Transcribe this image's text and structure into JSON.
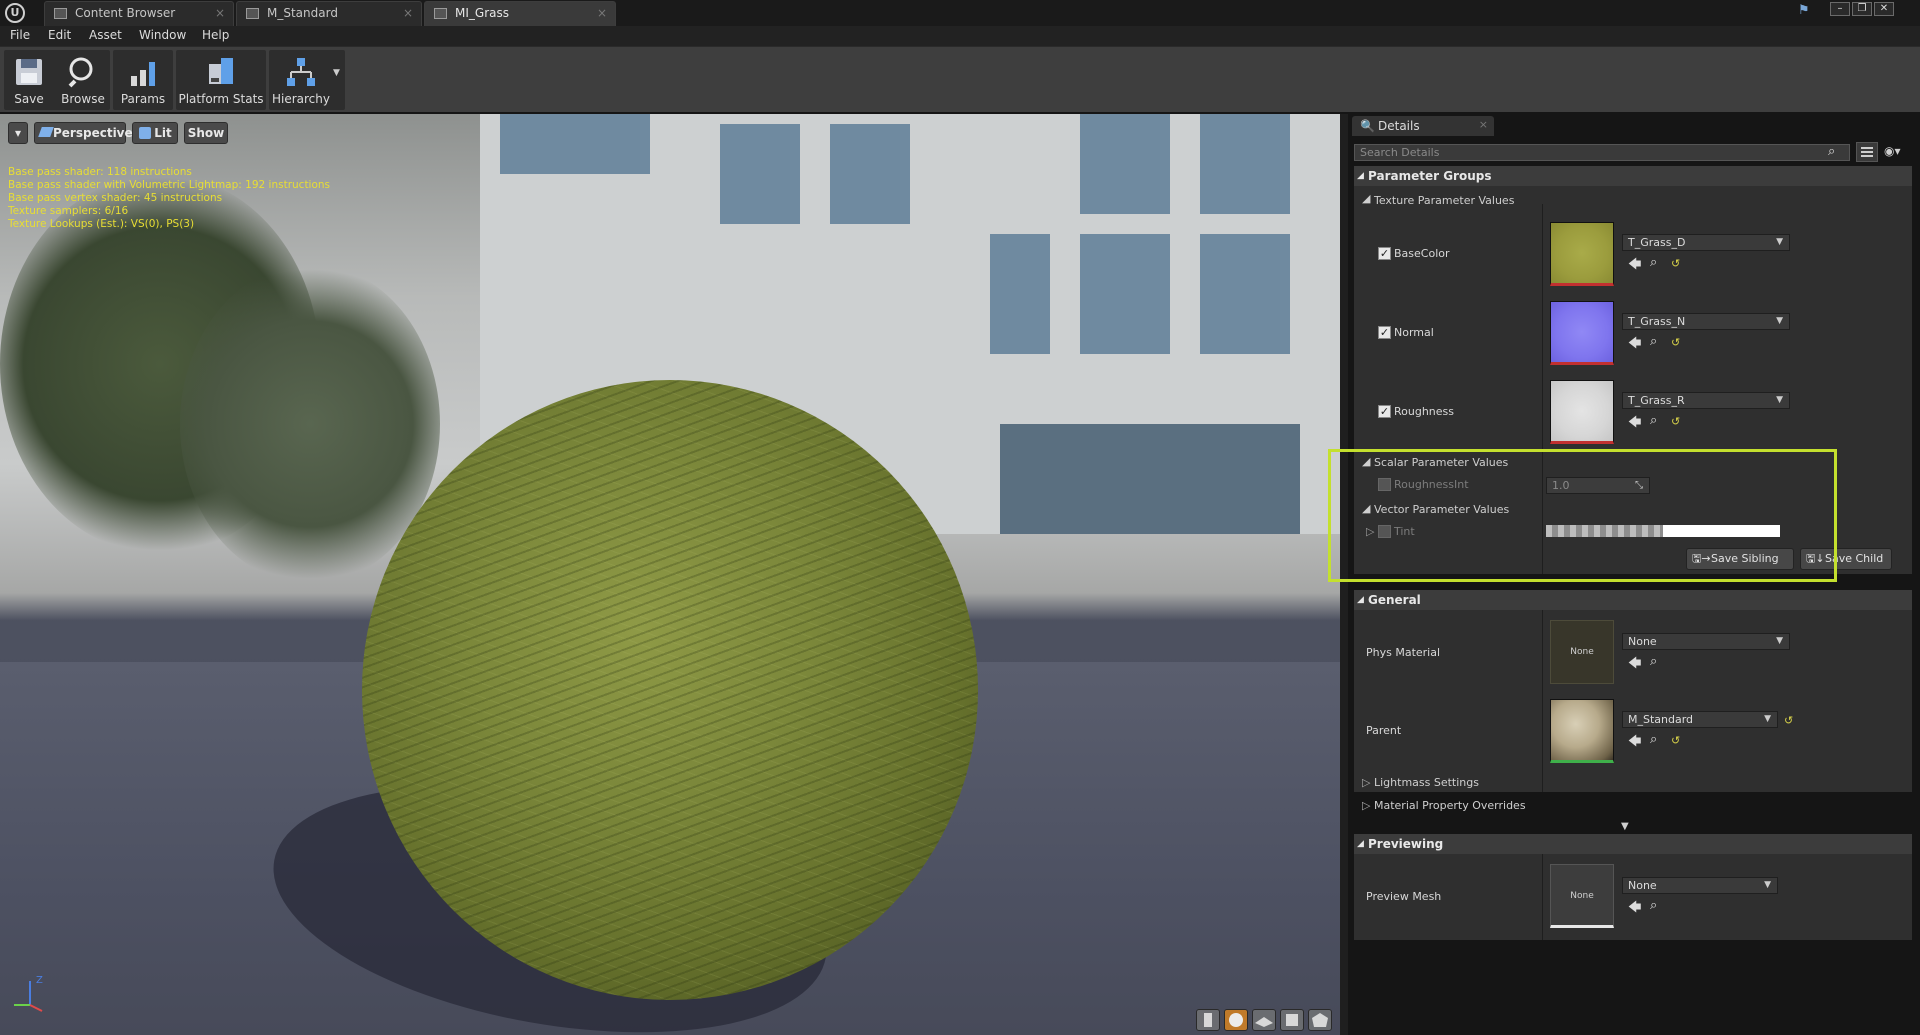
{
  "tabs": [
    {
      "label": "Content Browser",
      "active": false
    },
    {
      "label": "M_Standard",
      "active": false
    },
    {
      "label": "MI_Grass",
      "active": true
    }
  ],
  "menu": [
    "File",
    "Edit",
    "Asset",
    "Window",
    "Help"
  ],
  "toolbar": {
    "save": "Save",
    "browse": "Browse",
    "params": "Params",
    "platform_stats": "Platform Stats",
    "hierarchy": "Hierarchy"
  },
  "viewport": {
    "dropdown": "▾",
    "perspective": "Perspective",
    "lit": "Lit",
    "show": "Show",
    "stats": [
      "Base pass shader: 118 instructions",
      "Base pass shader with Volumetric Lightmap: 192 instructions",
      "Base pass vertex shader: 45 instructions",
      "Texture samplers: 6/16",
      "Texture Lookups (Est.): VS(0), PS(3)"
    ],
    "gizmo_z": "Z"
  },
  "details": {
    "tab_label": "Details",
    "search_placeholder": "Search Details",
    "parameter_groups": "Parameter Groups",
    "texture_params": "Texture Parameter Values",
    "basecolor_label": "BaseColor",
    "basecolor_value": "T_Grass_D",
    "normal_label": "Normal",
    "normal_value": "T_Grass_N",
    "roughness_label": "Roughness",
    "roughness_value": "T_Grass_R",
    "scalar_params": "Scalar Parameter Values",
    "roughnessint_label": "RoughnessInt",
    "roughnessint_value": "1.0",
    "vector_params": "Vector Parameter Values",
    "tint_label": "Tint",
    "save_sibling": "Save Sibling",
    "save_child": "Save Child",
    "general": "General",
    "phys_material_label": "Phys Material",
    "phys_material_thumb": "None",
    "phys_material_value": "None",
    "parent_label": "Parent",
    "parent_value": "M_Standard",
    "lightmass_settings": "Lightmass Settings",
    "material_property_overrides": "Material Property Overrides",
    "previewing": "Previewing",
    "preview_mesh_label": "Preview Mesh",
    "preview_mesh_thumb": "None",
    "preview_mesh_value": "None"
  },
  "colors": {
    "highlight": "#c4e02e",
    "stats_text": "#e8de33",
    "basecolor_swatch": "#a3a442",
    "normal_swatch": "#8a80f0",
    "roughness_swatch": "#d8d8d8"
  }
}
